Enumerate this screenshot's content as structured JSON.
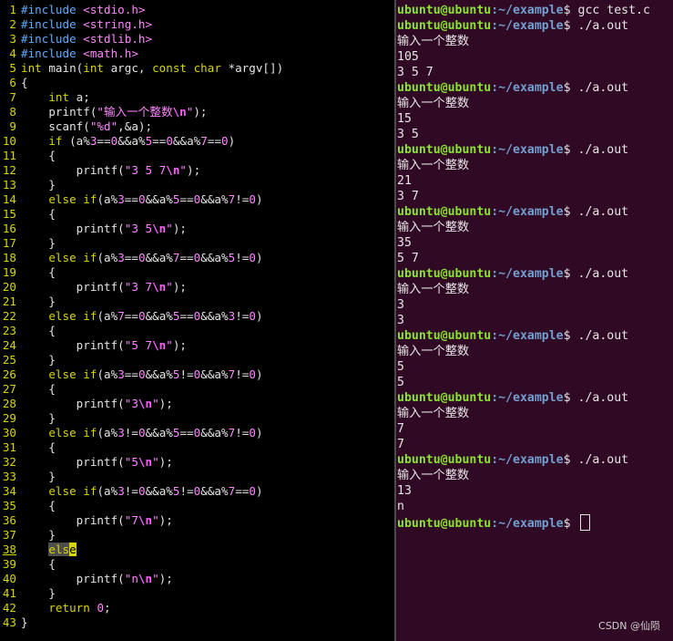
{
  "colors": {
    "editor_bg": "#000000",
    "terminal_bg": "#300a24",
    "keyword": "#d7d700",
    "preproc": "#5fafff",
    "string": "#ff87ff",
    "prompt_user": "#8ae234",
    "prompt_path": "#729fcf"
  },
  "editor": {
    "current_line": 38,
    "lines": [
      {
        "n": "1",
        "text": "#include <stdio.h>"
      },
      {
        "n": "2",
        "text": "#include <string.h>"
      },
      {
        "n": "3",
        "text": "#include <stdlib.h>"
      },
      {
        "n": "4",
        "text": "#include <math.h>"
      },
      {
        "n": "5",
        "text": "int main(int argc, const char *argv[])"
      },
      {
        "n": "6",
        "text": "{"
      },
      {
        "n": "7",
        "text": "    int a;"
      },
      {
        "n": "8",
        "text": "    printf(\"输入一个整数\\n\");"
      },
      {
        "n": "9",
        "text": "    scanf(\"%d\",&a);"
      },
      {
        "n": "10",
        "text": "    if (a%3==0&&a%5==0&&a%7==0)"
      },
      {
        "n": "11",
        "text": "    {"
      },
      {
        "n": "12",
        "text": "        printf(\"3 5 7\\n\");"
      },
      {
        "n": "13",
        "text": "    }"
      },
      {
        "n": "14",
        "text": "    else if(a%3==0&&a%5==0&&a%7!=0)"
      },
      {
        "n": "15",
        "text": "    {"
      },
      {
        "n": "16",
        "text": "        printf(\"3 5\\n\");"
      },
      {
        "n": "17",
        "text": "    }"
      },
      {
        "n": "18",
        "text": "    else if(a%3==0&&a%7==0&&a%5!=0)"
      },
      {
        "n": "19",
        "text": "    {"
      },
      {
        "n": "20",
        "text": "        printf(\"3 7\\n\");"
      },
      {
        "n": "21",
        "text": "    }"
      },
      {
        "n": "22",
        "text": "    else if(a%7==0&&a%5==0&&a%3!=0)"
      },
      {
        "n": "23",
        "text": "    {"
      },
      {
        "n": "24",
        "text": "        printf(\"5 7\\n\");"
      },
      {
        "n": "25",
        "text": "    }"
      },
      {
        "n": "26",
        "text": "    else if(a%3==0&&a%5!=0&&a%7!=0)"
      },
      {
        "n": "27",
        "text": "    {"
      },
      {
        "n": "28",
        "text": "        printf(\"3\\n\");"
      },
      {
        "n": "29",
        "text": "    }"
      },
      {
        "n": "30",
        "text": "    else if(a%3!=0&&a%5==0&&a%7!=0)"
      },
      {
        "n": "31",
        "text": "    {"
      },
      {
        "n": "32",
        "text": "        printf(\"5\\n\");"
      },
      {
        "n": "33",
        "text": "    }"
      },
      {
        "n": "34",
        "text": "    else if(a%3!=0&&a%5!=0&&a%7==0)"
      },
      {
        "n": "35",
        "text": "    {"
      },
      {
        "n": "36",
        "text": "        printf(\"7\\n\");"
      },
      {
        "n": "37",
        "text": "    }"
      },
      {
        "n": "38",
        "text": "    else"
      },
      {
        "n": "39",
        "text": "    {"
      },
      {
        "n": "40",
        "text": "        printf(\"n\\n\");"
      },
      {
        "n": "41",
        "text": "    }"
      },
      {
        "n": "42",
        "text": "    return 0;"
      },
      {
        "n": "43",
        "text": "}"
      }
    ]
  },
  "terminal": {
    "prompt_user": "ubuntu@ubuntu",
    "prompt_path": ":~/example",
    "prompt_suffix": "$ ",
    "lines": [
      {
        "type": "prompt",
        "cmd": "gcc test.c"
      },
      {
        "type": "prompt",
        "cmd": "./a.out"
      },
      {
        "type": "out",
        "text": "输入一个整数"
      },
      {
        "type": "out",
        "text": "105"
      },
      {
        "type": "out",
        "text": "3 5 7"
      },
      {
        "type": "prompt",
        "cmd": "./a.out"
      },
      {
        "type": "out",
        "text": "输入一个整数"
      },
      {
        "type": "out",
        "text": "15"
      },
      {
        "type": "out",
        "text": "3 5"
      },
      {
        "type": "prompt",
        "cmd": "./a.out"
      },
      {
        "type": "out",
        "text": "输入一个整数"
      },
      {
        "type": "out",
        "text": "21"
      },
      {
        "type": "out",
        "text": "3 7"
      },
      {
        "type": "prompt",
        "cmd": "./a.out"
      },
      {
        "type": "out",
        "text": "输入一个整数"
      },
      {
        "type": "out",
        "text": "35"
      },
      {
        "type": "out",
        "text": "5 7"
      },
      {
        "type": "prompt",
        "cmd": "./a.out"
      },
      {
        "type": "out",
        "text": "输入一个整数"
      },
      {
        "type": "out",
        "text": "3"
      },
      {
        "type": "out",
        "text": "3"
      },
      {
        "type": "prompt",
        "cmd": "./a.out"
      },
      {
        "type": "out",
        "text": "输入一个整数"
      },
      {
        "type": "out",
        "text": "5"
      },
      {
        "type": "out",
        "text": "5"
      },
      {
        "type": "prompt",
        "cmd": "./a.out"
      },
      {
        "type": "out",
        "text": "输入一个整数"
      },
      {
        "type": "out",
        "text": "7"
      },
      {
        "type": "out",
        "text": "7"
      },
      {
        "type": "prompt",
        "cmd": "./a.out"
      },
      {
        "type": "out",
        "text": "输入一个整数"
      },
      {
        "type": "out",
        "text": "13"
      },
      {
        "type": "out",
        "text": "n"
      },
      {
        "type": "prompt",
        "cmd": ""
      }
    ]
  },
  "watermark": "CSDN @仙陨"
}
